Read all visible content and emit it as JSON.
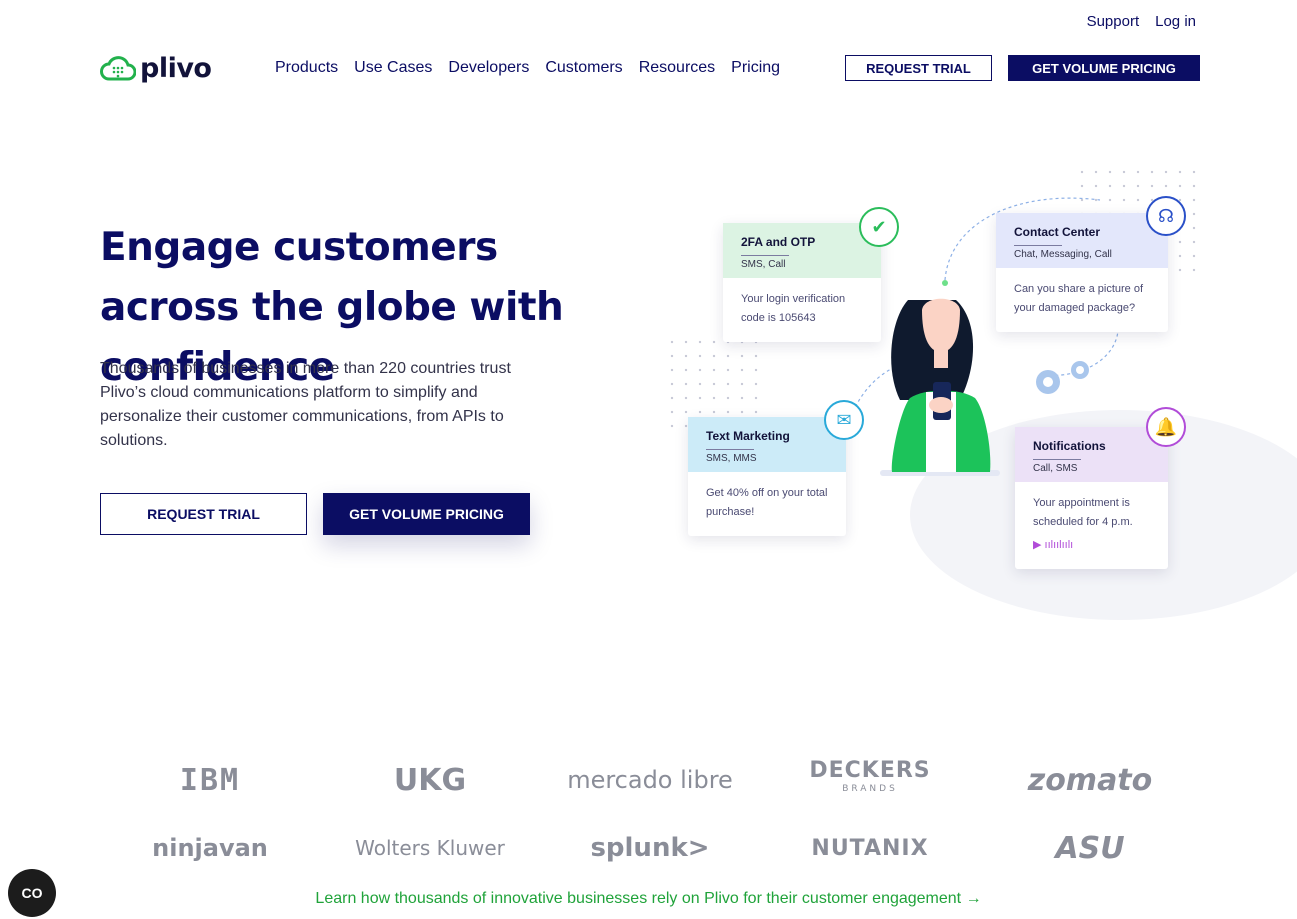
{
  "util_links": {
    "support": "Support",
    "login": "Log in"
  },
  "brand": {
    "name": "plivo",
    "accent": "#22b14c",
    "navy": "#0b0d63"
  },
  "nav": [
    "Products",
    "Use Cases",
    "Developers",
    "Customers",
    "Resources",
    "Pricing"
  ],
  "header_buttons": {
    "trial": "REQUEST TRIAL",
    "pricing": "GET VOLUME PRICING"
  },
  "hero": {
    "title": "Engage customers across the globe with confidence",
    "subtitle": "Thousands of businesses in more than 220 countries trust Plivo’s cloud communications platform to simplify and personalize their customer communications, from APIs to solutions.",
    "trial": "REQUEST TRIAL",
    "pricing": "GET VOLUME PRICING"
  },
  "cards": {
    "otp": {
      "title": "2FA and OTP",
      "sub": "SMS, Call",
      "body": "Your login verification code is 105643",
      "color": "#dcf3e3",
      "icon": "shield-check-icon"
    },
    "contact": {
      "title": "Contact Center",
      "sub": "Chat, Messaging, Call",
      "body": "Can you share a picture of your damaged package?",
      "color": "#e3e7fb",
      "icon": "headset-icon"
    },
    "text": {
      "title": "Text Marketing",
      "sub": "SMS, MMS",
      "body": "Get 40% off on your total purchase!",
      "color": "#ccebf8",
      "icon": "chat-bubble-icon"
    },
    "notif": {
      "title": "Notifications",
      "sub": "Call, SMS",
      "body": "Your appointment is scheduled for 4 p.m.",
      "color": "#ece1f7",
      "icon": "bell-icon"
    }
  },
  "logos": {
    "row1": [
      "IBM",
      "UKG",
      "mercado libre",
      "DECKERS",
      "zomato"
    ],
    "deckers_sub": "BRANDS",
    "row2": [
      "ninjavan",
      "Wolters Kluwer",
      "splunk>",
      "NUTANIX",
      "ASU"
    ]
  },
  "learn_link": "Learn how thousands of innovative businesses rely on Plivo for their customer engagement →",
  "float_button": "CO"
}
